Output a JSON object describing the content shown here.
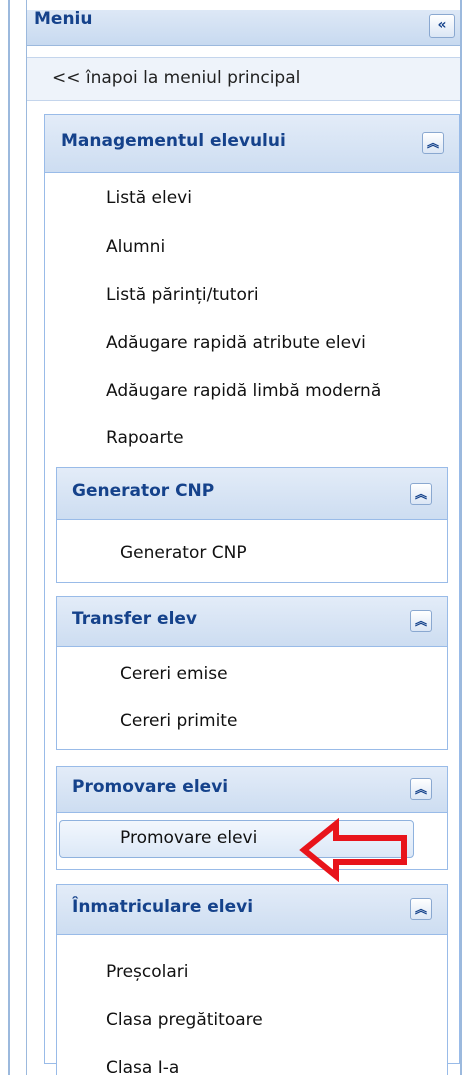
{
  "menu": {
    "title": "Meniu",
    "collapse_icon": "double-chevron-left-icon",
    "back_link": "<< înapoi la meniul principal"
  },
  "panels": {
    "management": {
      "title": "Managementul elevului",
      "items": [
        "Listă elevi",
        "Alumni",
        "Listă părinți/tutori",
        "Adăugare rapidă atribute elevi",
        "Adăugare rapidă limbă modernă",
        "Rapoarte"
      ]
    },
    "cnp": {
      "title": "Generator CNP",
      "items": [
        "Generator CNP"
      ]
    },
    "transfer": {
      "title": "Transfer elev",
      "items": [
        "Cereri emise",
        "Cereri primite"
      ]
    },
    "promovare": {
      "title": "Promovare elevi",
      "items": [
        "Promovare elevi"
      ]
    },
    "inmatriculare": {
      "title": "Înmatriculare elevi",
      "items": [
        "Preșcolari",
        "Clasa pregătitoare",
        "Clasa I-a"
      ]
    }
  },
  "colors": {
    "header_text": "#15428b",
    "border": "#99bbe8",
    "annotation_arrow": "#e8141b"
  }
}
